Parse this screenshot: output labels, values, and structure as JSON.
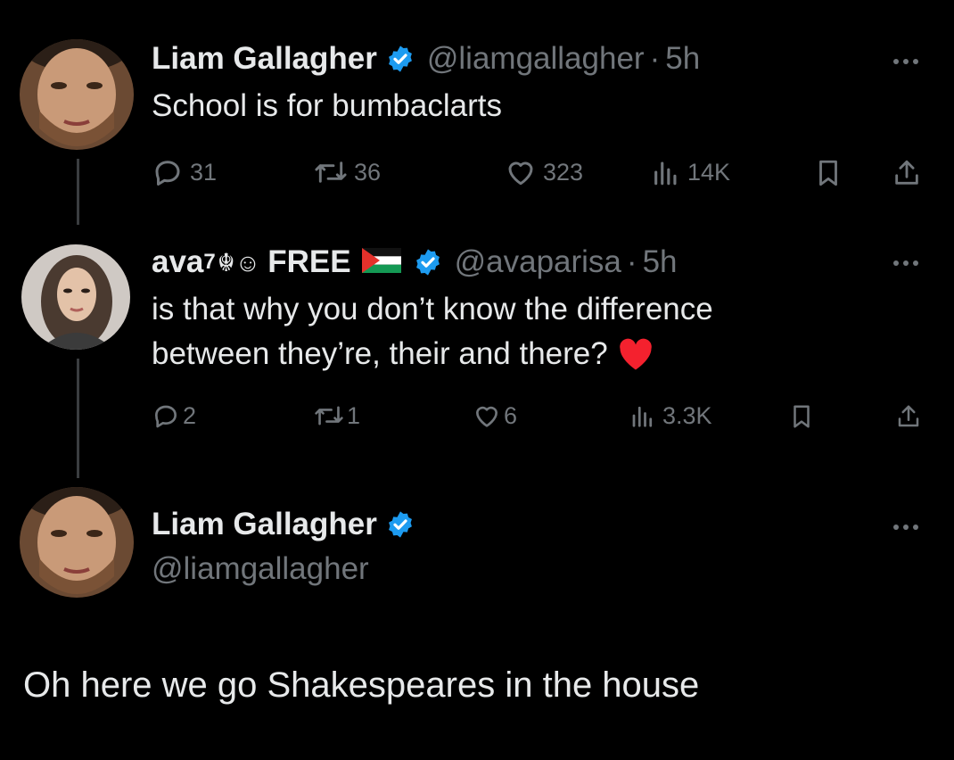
{
  "tweets": [
    {
      "display_name": "Liam Gallagher",
      "handle": "@liamgallagher",
      "time": "5h",
      "text": "School is for bumbaclarts",
      "replies": "31",
      "reposts": "36",
      "likes": "323",
      "views": "14K"
    },
    {
      "display_name_prefix": "ava",
      "superscript": "7",
      "emoji_glyphs": "☬☺",
      "display_name_suffix": "FREE",
      "handle": "@avaparisa",
      "time": "5h",
      "text_line1": "is that why you don’t know the difference",
      "text_line2": "between they’re, their and there?",
      "replies": "2",
      "reposts": "1",
      "likes": "6",
      "views": "3.3K"
    },
    {
      "display_name": "Liam Gallagher",
      "handle": "@liamgallagher",
      "text": "Oh here we go Shakespeares in the house"
    }
  ],
  "separator": "·",
  "colors": {
    "background": "#000000",
    "verified": "#1d9bf0",
    "muted": "#71767b",
    "heart": "#f4212e"
  },
  "icons": [
    "reply-icon",
    "repost-icon",
    "like-icon",
    "views-icon",
    "bookmark-icon",
    "share-icon",
    "verified-icon",
    "more-icon",
    "palestine-flag-icon",
    "heart-emoji-icon"
  ]
}
